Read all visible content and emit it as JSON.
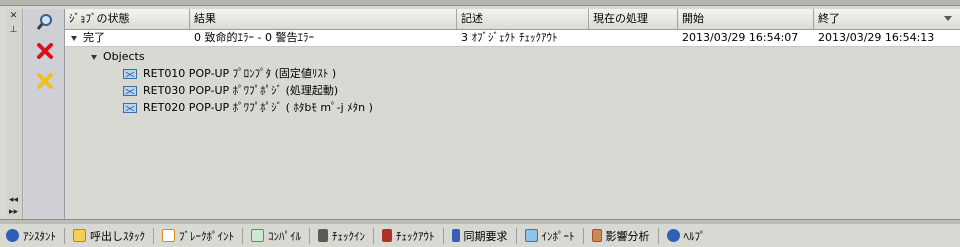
{
  "columns": [
    {
      "label": "ｼﾞｮﾌﾞの状態"
    },
    {
      "label": "結果"
    },
    {
      "label": "記述"
    },
    {
      "label": "現在の処理"
    },
    {
      "label": "開始"
    },
    {
      "label": "終了"
    }
  ],
  "job": {
    "status": "完了",
    "result": "0 致命的ｴﾗｰ - 0 警告ｴﾗｰ",
    "description": "3 ｵﾌﾞｼﾞｪｸﾄ ﾁｪｯｸｱｳﾄ",
    "current": "",
    "start": "2013/03/29 16:54:07",
    "end": "2013/03/29 16:54:13"
  },
  "tree": {
    "group_label": "Objects",
    "items": [
      {
        "label": "RET010  POP-UP ﾌﾟﾛﾝﾌﾟﾀ (固定値ﾘｽﾄ )"
      },
      {
        "label": "RET030   POP-UP ﾎﾟﾜﾌﾟﾎﾟｼﾞ (処理起動)"
      },
      {
        "label": "RET020   POP-UP ﾎﾟﾜﾌﾟﾎﾟｼﾞ ( ﾎﾀbﾓ mﾟ-j ﾒﾀn )"
      }
    ]
  },
  "tabs": [
    {
      "label": "ｱｼｽﾀﾝﾄ",
      "icon": "info-icon",
      "color": "#2b62b8"
    },
    {
      "label": "呼出しｽﾀｯｸ",
      "icon": "stack-icon",
      "color": "#e3b02a"
    },
    {
      "label": "ﾌﾞﾚｰｸﾎﾟｲﾝﾄ",
      "icon": "breakpoint-icon",
      "color": "#e08a1e"
    },
    {
      "label": "ｺﾝﾊﾟｲﾙ",
      "icon": "compile-icon",
      "color": "#4a9a5a"
    },
    {
      "label": "ﾁｪｯｸｲﾝ",
      "icon": "checkin-icon",
      "color": "#5a5a5a"
    },
    {
      "label": "ﾁｪｯｸｱｳﾄ",
      "icon": "checkout-icon",
      "color": "#b0302a"
    },
    {
      "label": "同期要求",
      "icon": "sync-icon",
      "color": "#3a5fb0"
    },
    {
      "label": "ｲﾝﾎﾟｰﾄ",
      "icon": "import-icon",
      "color": "#2a7fb8"
    },
    {
      "label": "影響分析",
      "icon": "impact-icon",
      "color": "#a0522d"
    },
    {
      "label": "ﾍﾙﾌﾟ",
      "icon": "help-icon",
      "color": "#2b62b8"
    }
  ]
}
